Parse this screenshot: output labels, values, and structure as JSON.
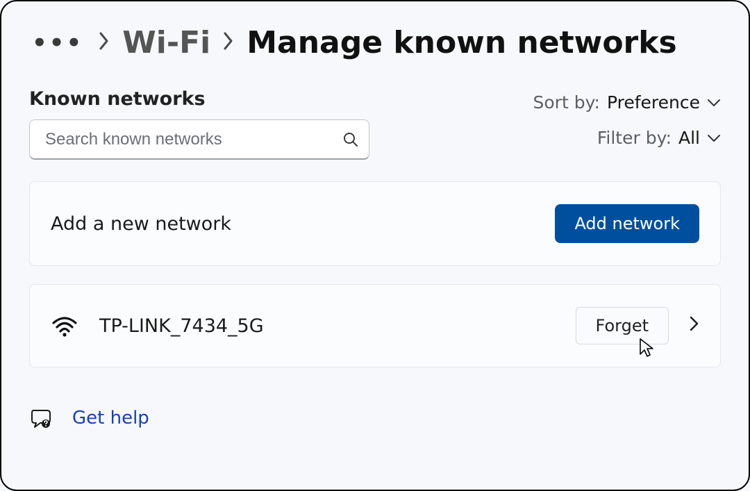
{
  "breadcrumb": {
    "ellipsis": "•••",
    "wifi": "Wi-Fi",
    "current": "Manage known networks"
  },
  "known_label": "Known networks",
  "search": {
    "placeholder": "Search known networks"
  },
  "sort": {
    "label": "Sort by:",
    "value": "Preference"
  },
  "filter": {
    "label": "Filter by:",
    "value": "All"
  },
  "add_card": {
    "title": "Add a new network",
    "button": "Add network"
  },
  "networks": [
    {
      "name": "TP-LINK_7434_5G",
      "forget": "Forget"
    }
  ],
  "help": {
    "label": "Get help"
  }
}
